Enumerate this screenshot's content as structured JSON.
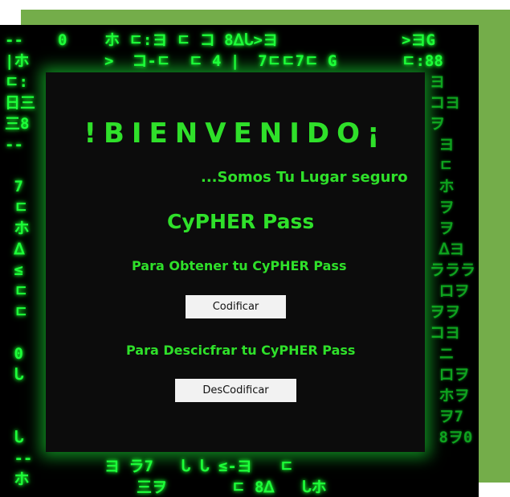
{
  "welcome": {
    "title": "!BIENVENIDO¡",
    "tagline": "...Somos Tu Lugar seguro",
    "brand": "CyPHER Pass"
  },
  "encode_section": {
    "heading": "Para Obtener tu CyPHER Pass",
    "button_label": "Codificar"
  },
  "decode_section": {
    "heading": "Para Descicfrar tu CyPHER Pass",
    "button_label": "DesCodificar"
  },
  "colors": {
    "frame": "#74ad4a",
    "text_green": "#2fe02a",
    "matrix_green": "#1eff3a",
    "panel": "#0c0c0c"
  }
}
